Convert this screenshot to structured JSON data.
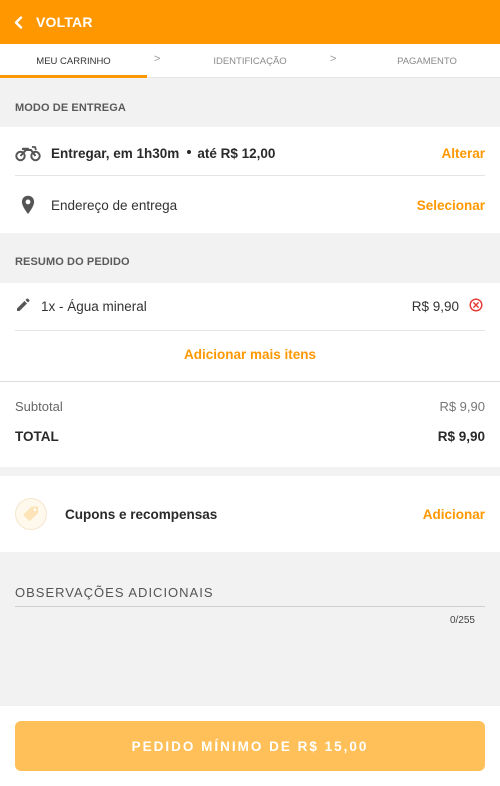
{
  "topbar": {
    "back_label": "VOLTAR"
  },
  "steps": {
    "items": [
      "MEU CARRINHO",
      "IDENTIFICAÇÃO",
      "PAGAMENTO"
    ],
    "separator": ">"
  },
  "delivery": {
    "section_title": "MODO DE ENTREGA",
    "mode_text": "Entregar, em 1h30m",
    "mode_price": "até R$ 12,00",
    "change_label": "Alterar",
    "address_text": "Endereço de entrega",
    "select_label": "Selecionar"
  },
  "order": {
    "section_title": "RESUMO DO PEDIDO",
    "items": [
      {
        "label": "1x - Água mineral",
        "price": "R$ 9,90"
      }
    ],
    "add_more_label": "Adicionar mais itens"
  },
  "totals": {
    "subtotal_label": "Subtotal",
    "subtotal_value": "R$ 9,90",
    "total_label": "TOTAL",
    "total_value": "R$ 9,90"
  },
  "coupons": {
    "label": "Cupons e recompensas",
    "add_label": "Adicionar"
  },
  "observations": {
    "label": "OBSERVAÇÕES ADICIONAIS",
    "counter": "0/255"
  },
  "cta": {
    "label": "PEDIDO MÍNIMO DE R$ 15,00"
  },
  "colors": {
    "accent": "#ff9800",
    "cta_disabled": "#ffc05a",
    "remove": "#e53935"
  },
  "icons": [
    "chevron-left-icon",
    "motorcycle-icon",
    "location-pin-icon",
    "pencil-icon",
    "remove-circle-icon",
    "coupon-tag-icon"
  ]
}
